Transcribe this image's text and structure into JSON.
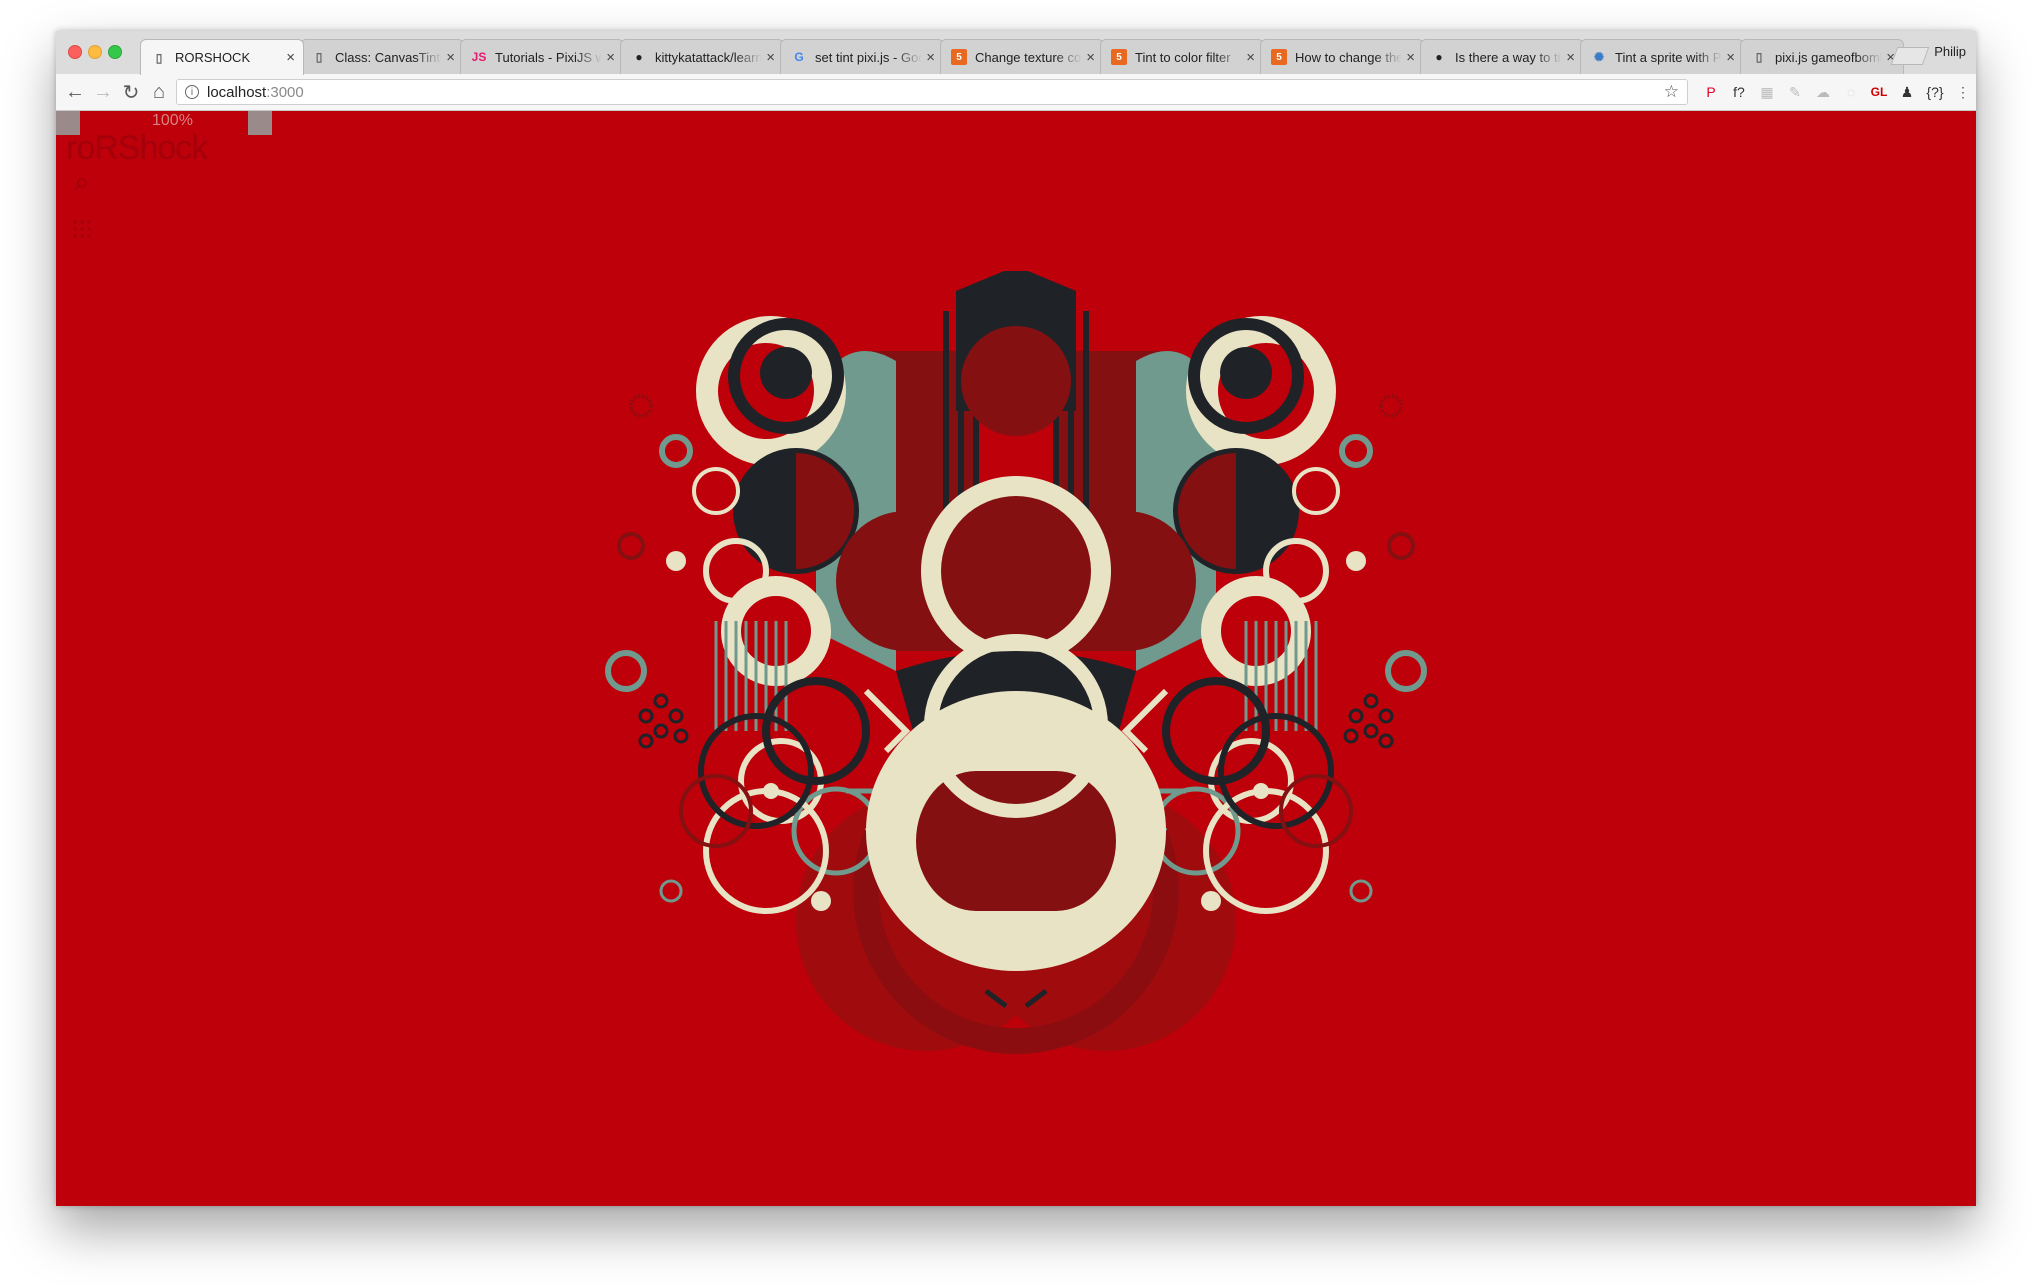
{
  "browser": {
    "tabs": [
      {
        "title": "RORSHOCK",
        "favicon": "page-icon",
        "active": true
      },
      {
        "title": "Class: CanvasTinter",
        "favicon": "page-icon",
        "active": false
      },
      {
        "title": "Tutorials - PixiJS wiki",
        "favicon": "js-icon",
        "active": false
      },
      {
        "title": "kittykatattack/learningPixi",
        "favicon": "github-icon",
        "active": false
      },
      {
        "title": "set tint pixi.js - Google Search",
        "favicon": "google-icon",
        "active": false
      },
      {
        "title": "Change texture color",
        "favicon": "html5-icon",
        "active": false
      },
      {
        "title": "Tint to color filter",
        "favicon": "html5-icon",
        "active": false
      },
      {
        "title": "How to change the tint",
        "favicon": "html5-icon",
        "active": false
      },
      {
        "title": "Is there a way to tint",
        "favicon": "github-icon",
        "active": false
      },
      {
        "title": "Tint a sprite with Pixi",
        "favicon": "pixi-icon",
        "active": false
      },
      {
        "title": "pixi.js gameofbombs",
        "favicon": "page-icon",
        "active": false
      }
    ],
    "tab_close_glyph": "×",
    "profile_name": "Philip",
    "url_host": "localhost",
    "url_port": ":3000",
    "extensions": [
      {
        "name": "pinterest-icon",
        "glyph": "P"
      },
      {
        "name": "font-finder-icon",
        "glyph": "f?"
      },
      {
        "name": "extension-grid-icon",
        "glyph": "▦"
      },
      {
        "name": "extension-feather-icon",
        "glyph": "✎"
      },
      {
        "name": "extension-cloud-icon",
        "glyph": "☁"
      },
      {
        "name": "extension-eye-icon",
        "glyph": "◌"
      },
      {
        "name": "webgl-inspector-icon",
        "glyph": "GL"
      },
      {
        "name": "extension-person-icon",
        "glyph": "♟"
      },
      {
        "name": "json-formatter-icon",
        "glyph": "{?}"
      },
      {
        "name": "menu-icon",
        "glyph": "⋮"
      }
    ],
    "nav_icons": {
      "back": "←",
      "forward": "→",
      "reload": "↻",
      "home": "⌂",
      "bookmark_star": "☆",
      "info": "i"
    }
  },
  "page": {
    "hud_percent": "100%",
    "hud_title": "roRShock",
    "colors": {
      "background": "#bd000a",
      "dark_red": "#841012",
      "cream": "#e9e3c6",
      "charcoal": "#1f2328",
      "sage": "#6f9a8d"
    }
  }
}
